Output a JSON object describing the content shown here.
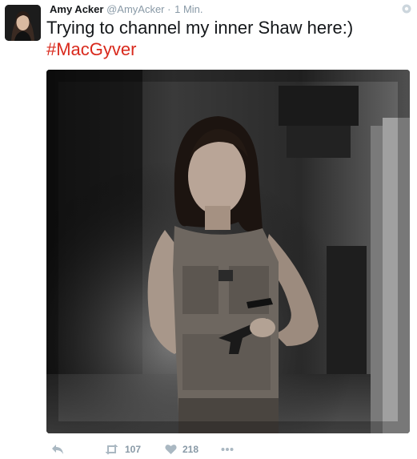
{
  "user": {
    "display_name": "Amy Acker",
    "handle": "@AmyAcker",
    "separator": "·",
    "time": "1 Min."
  },
  "tweet": {
    "text": "Trying to channel my inner Shaw here:)",
    "hashtag": "#MacGyver"
  },
  "media": {
    "icon": "photo"
  },
  "actions": {
    "reply_icon": "reply-icon",
    "retweet_count": "107",
    "like_count": "218",
    "more_icon": "more-icon"
  },
  "colors": {
    "name": "#14171a",
    "muted": "#8899a6",
    "hashtag": "#d9291c",
    "action": "#aab8c2"
  }
}
